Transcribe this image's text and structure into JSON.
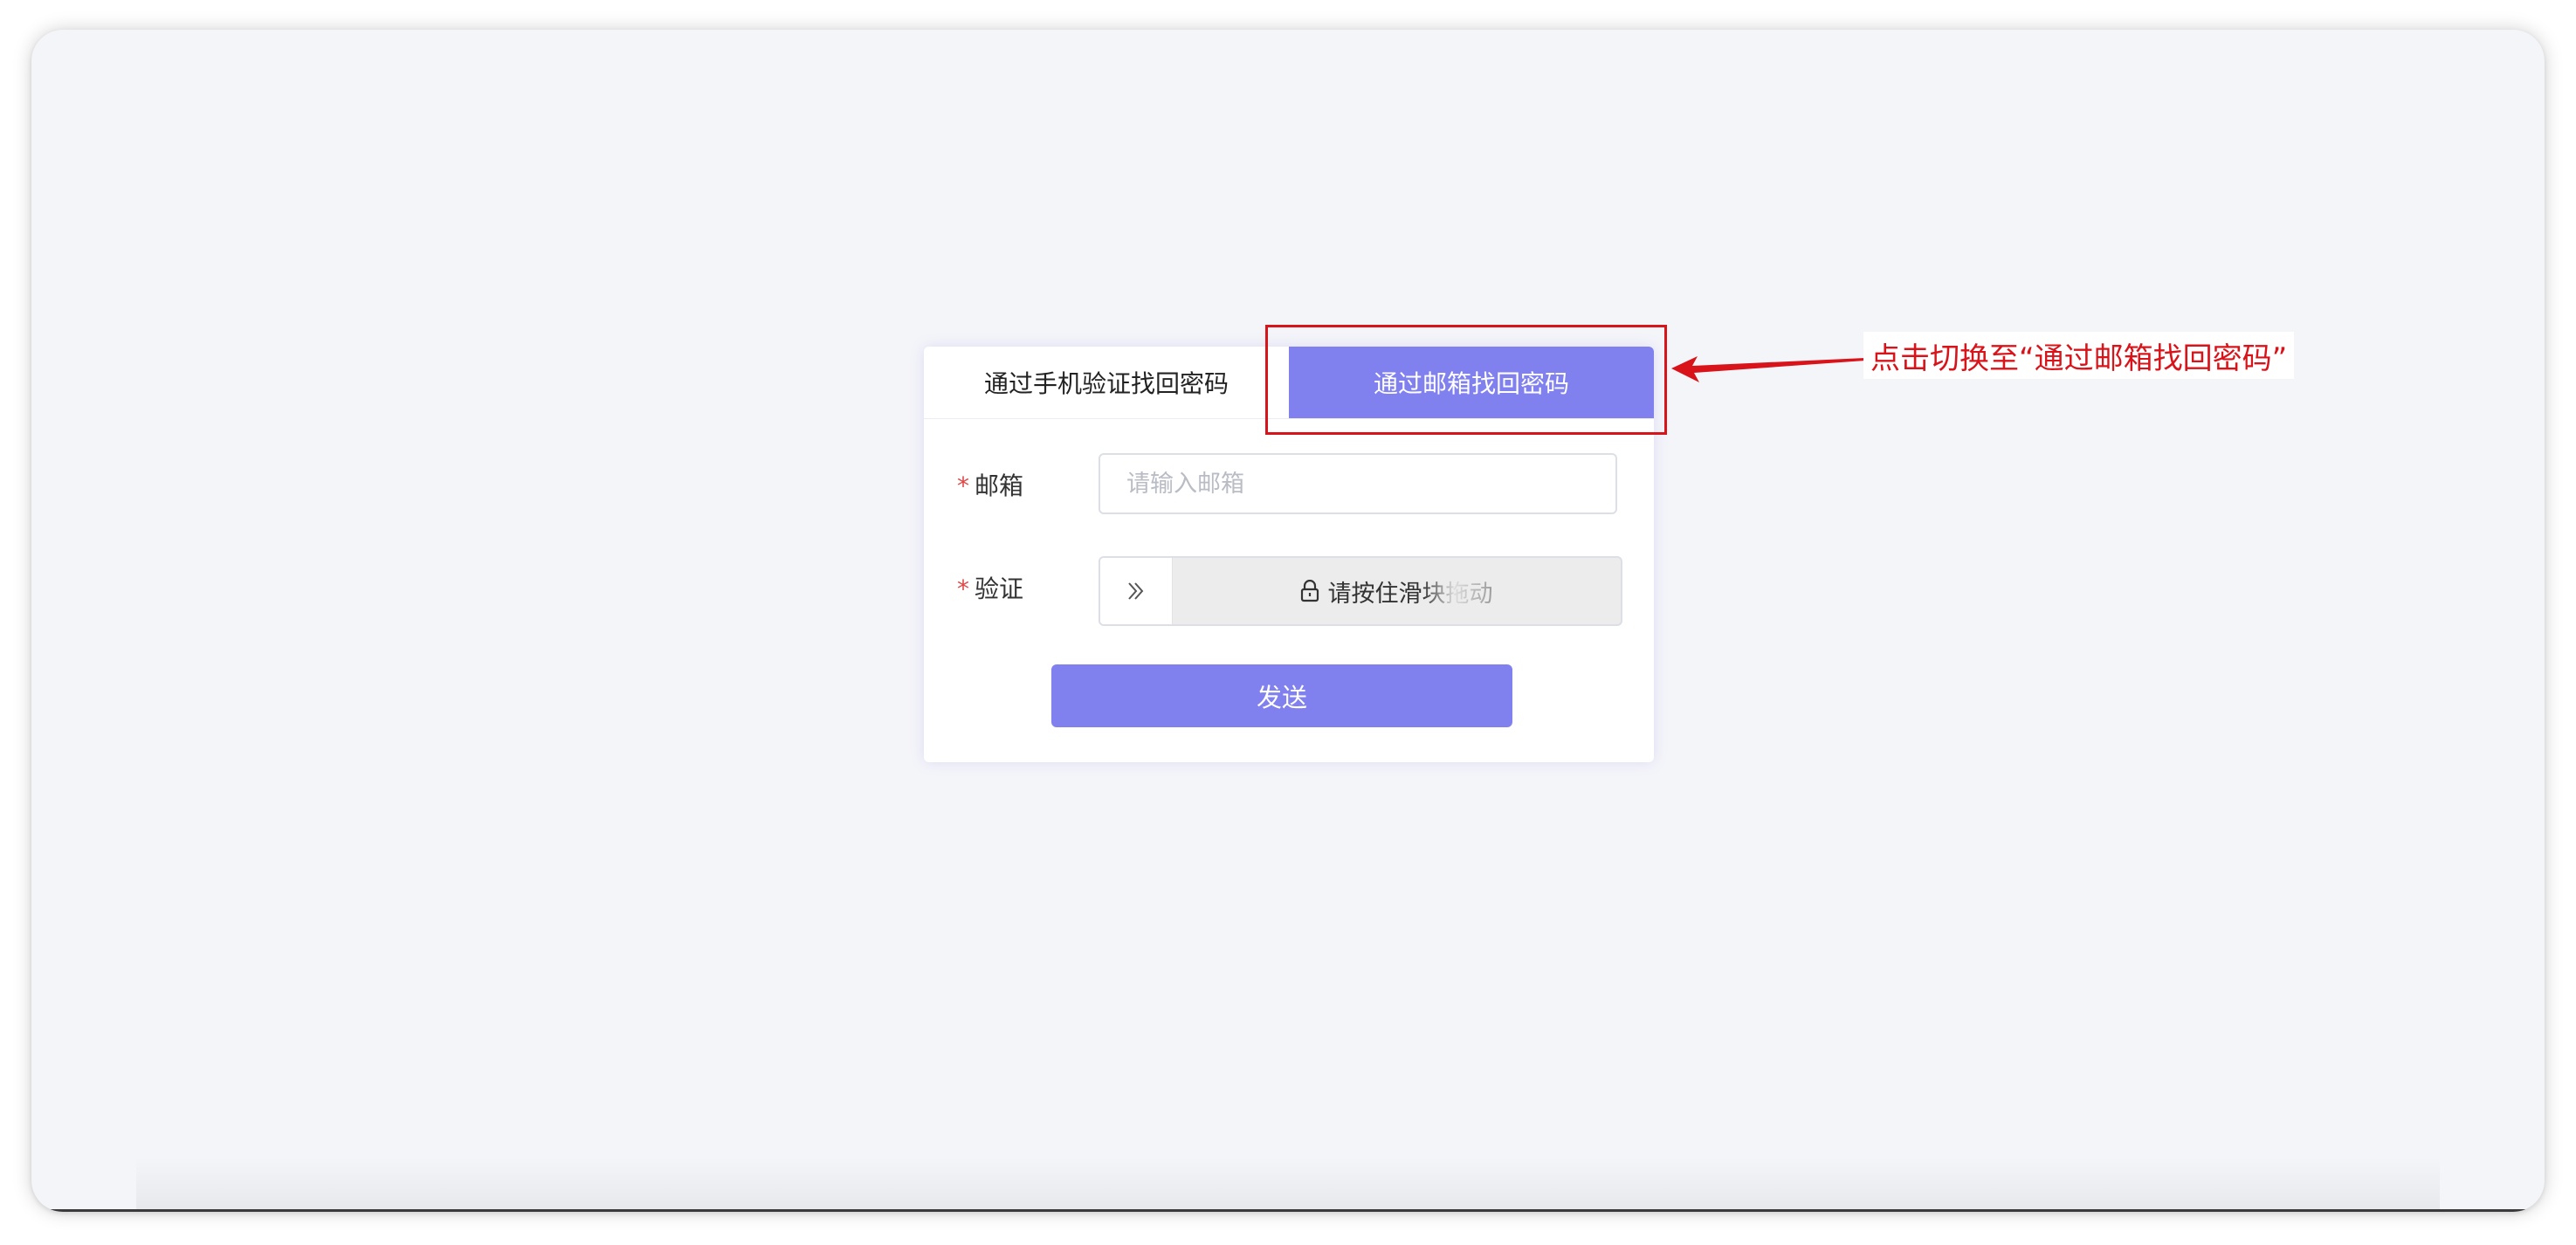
{
  "tabs": {
    "phone": "通过手机验证找回密码",
    "email": "通过邮箱找回密码",
    "active": "email"
  },
  "form": {
    "email_label": "邮箱",
    "email_placeholder": "请输入邮箱",
    "email_value": "",
    "verify_label": "验证",
    "slider_text_solid": "请按住滑",
    "slider_text_faded": "块拖动",
    "required_mark": "*"
  },
  "send_button": {
    "label": "发送"
  },
  "annotation": {
    "callout_text": "点击切换至“通过邮箱找回密码”",
    "color": "#d8141a"
  },
  "colors": {
    "accent": "#8080ef",
    "background": "#f4f5f9",
    "required": "#e04848"
  },
  "icons": {
    "slider_handle": "double-chevron-right-icon",
    "slider_lock": "lock-icon"
  }
}
